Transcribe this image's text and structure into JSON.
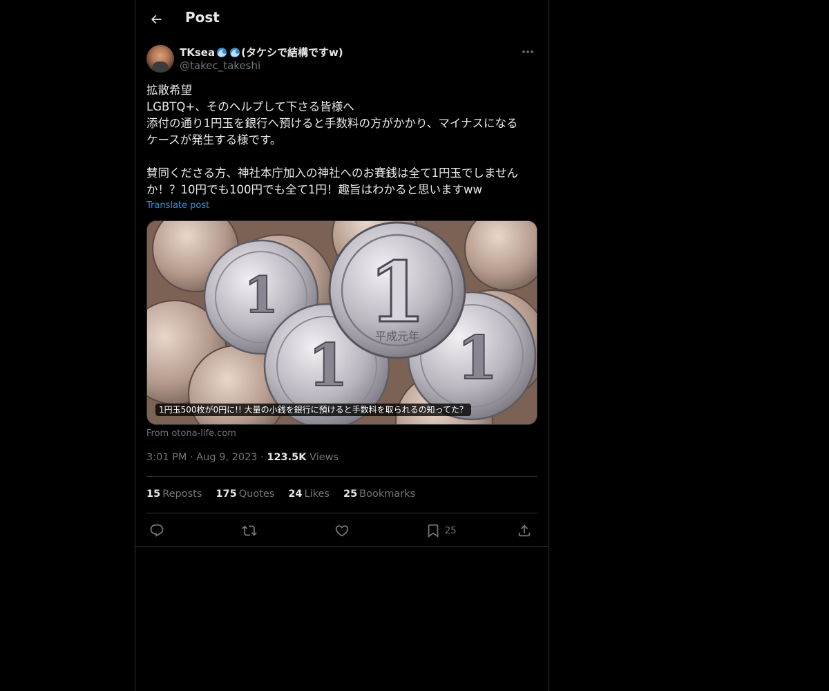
{
  "header": {
    "title": "Post"
  },
  "author": {
    "display_name": "TKsea",
    "name_suffix": "(タケシで結構ですw)",
    "handle": "@takec_takeshi"
  },
  "post": {
    "lines": [
      "拡散希望",
      "LGBTQ+、そのヘルプして下さる皆様へ",
      "添付の通り1円玉を銀行へ預けると手数料の方がかかり、マイナスになる",
      "ケースが発生する様です。",
      "",
      "賛同くださる方、神社本庁加入の神社へのお賽銭は全て1円玉でしません",
      "か！？10円でも100円でも全て1円！趣旨はわかると思いますww"
    ],
    "translate_label": "Translate post"
  },
  "media": {
    "caption": "1円玉500枚が0円に!! 大量の小銭を銀行に預けると手数料を取られるの知ってた？",
    "coin_text": "平成元年",
    "source": "From otona-life.com"
  },
  "meta": {
    "time": "3:01 PM",
    "date": "Aug 9, 2023",
    "views_count": "123.5K",
    "views_label": "Views",
    "separator": "·"
  },
  "stats": [
    {
      "count": "15",
      "label": "Reposts"
    },
    {
      "count": "175",
      "label": "Quotes"
    },
    {
      "count": "24",
      "label": "Likes"
    },
    {
      "count": "25",
      "label": "Bookmarks"
    }
  ],
  "actions": {
    "bookmark_count": "25"
  },
  "colors": {
    "background": "#000000",
    "text": "#e7e9ea",
    "muted": "#71767b",
    "link": "#1d9bf0",
    "border": "#2f3336"
  }
}
